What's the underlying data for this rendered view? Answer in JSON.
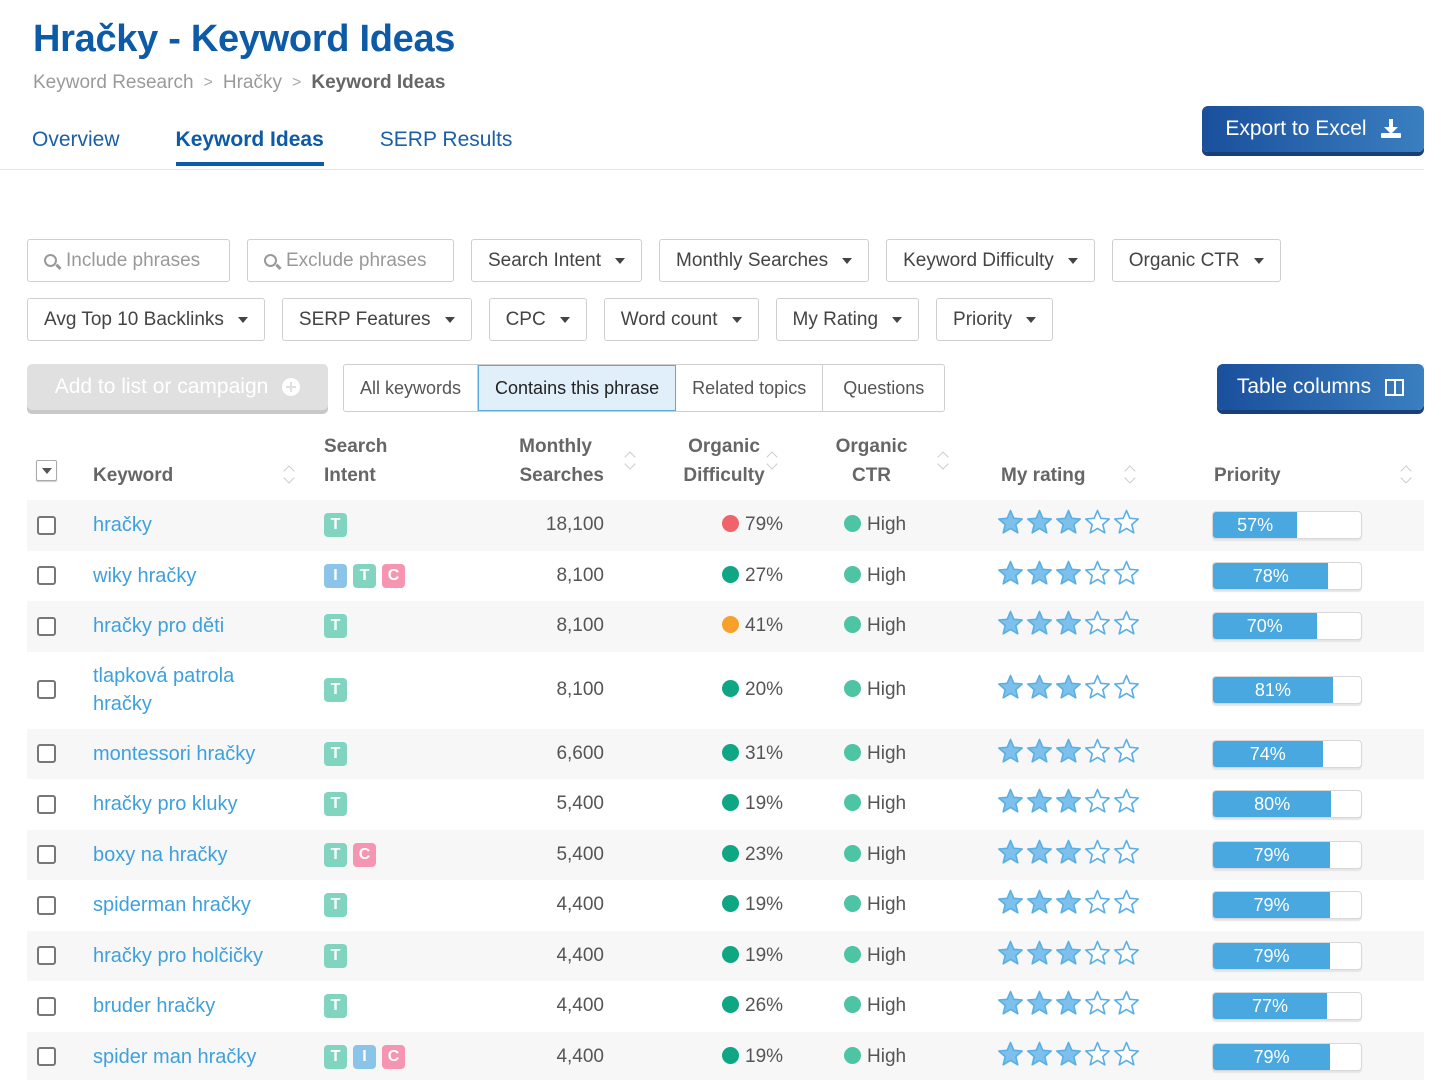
{
  "header": {
    "title": "Hračky - Keyword Ideas",
    "breadcrumb": [
      {
        "label": "Keyword Research"
      },
      {
        "label": "Hračky"
      },
      {
        "label": "Keyword Ideas"
      }
    ],
    "breadcrumb_separator": ">",
    "export_label": "Export to Excel"
  },
  "tabs": [
    {
      "label": "Overview",
      "active": false
    },
    {
      "label": "Keyword Ideas",
      "active": true
    },
    {
      "label": "SERP Results",
      "active": false
    }
  ],
  "filters": {
    "include_placeholder": "Include phrases",
    "exclude_placeholder": "Exclude phrases",
    "row1": [
      "Search Intent",
      "Monthly Searches",
      "Keyword Difficulty",
      "Organic CTR"
    ],
    "row2": [
      "Avg Top 10 Backlinks",
      "SERP Features",
      "CPC",
      "Word count",
      "My Rating",
      "Priority"
    ]
  },
  "toolbar": {
    "add_label": "Add to list or campaign",
    "segments": [
      "All keywords",
      "Contains this phrase",
      "Related topics",
      "Questions"
    ],
    "active_segment": "Contains this phrase",
    "table_columns_label": "Table columns"
  },
  "table": {
    "headers": {
      "keyword": "Keyword",
      "intent_1": "Search",
      "intent_2": "Intent",
      "searches_1": "Monthly",
      "searches_2": "Searches",
      "difficulty_1": "Organic",
      "difficulty_2": "Difficulty",
      "ctr_1": "Organic",
      "ctr_2": "CTR",
      "rating": "My rating",
      "priority": "Priority"
    },
    "colors": {
      "difficulty_hard": "#f0636b",
      "difficulty_medium": "#f7a12a",
      "difficulty_easy": "#0fa683",
      "ctr_high": "#4dc4a4",
      "star": "#5aafe4",
      "priority_fill": "#49a8e0"
    },
    "rows": [
      {
        "keyword": "hračky",
        "intent": [
          "T"
        ],
        "searches": "18,100",
        "difficulty": "79%",
        "difficulty_level": "hard",
        "ctr": "High",
        "rating": 3,
        "priority": 57,
        "priority_label": "57%"
      },
      {
        "keyword": "wiky hračky",
        "intent": [
          "I",
          "T",
          "C"
        ],
        "searches": "8,100",
        "difficulty": "27%",
        "difficulty_level": "easy",
        "ctr": "High",
        "rating": 3,
        "priority": 78,
        "priority_label": "78%"
      },
      {
        "keyword": "hračky pro děti",
        "intent": [
          "T"
        ],
        "searches": "8,100",
        "difficulty": "41%",
        "difficulty_level": "medium",
        "ctr": "High",
        "rating": 3,
        "priority": 70,
        "priority_label": "70%"
      },
      {
        "keyword": "tlapková patrola hračky",
        "intent": [
          "T"
        ],
        "searches": "8,100",
        "difficulty": "20%",
        "difficulty_level": "easy",
        "ctr": "High",
        "rating": 3,
        "priority": 81,
        "priority_label": "81%"
      },
      {
        "keyword": "montessori hračky",
        "intent": [
          "T"
        ],
        "searches": "6,600",
        "difficulty": "31%",
        "difficulty_level": "easy",
        "ctr": "High",
        "rating": 3,
        "priority": 74,
        "priority_label": "74%"
      },
      {
        "keyword": "hračky pro kluky",
        "intent": [
          "T"
        ],
        "searches": "5,400",
        "difficulty": "19%",
        "difficulty_level": "easy",
        "ctr": "High",
        "rating": 3,
        "priority": 80,
        "priority_label": "80%"
      },
      {
        "keyword": "boxy na hračky",
        "intent": [
          "T",
          "C"
        ],
        "searches": "5,400",
        "difficulty": "23%",
        "difficulty_level": "easy",
        "ctr": "High",
        "rating": 3,
        "priority": 79,
        "priority_label": "79%"
      },
      {
        "keyword": "spiderman hračky",
        "intent": [
          "T"
        ],
        "searches": "4,400",
        "difficulty": "19%",
        "difficulty_level": "easy",
        "ctr": "High",
        "rating": 3,
        "priority": 79,
        "priority_label": "79%"
      },
      {
        "keyword": "hračky pro holčičky",
        "intent": [
          "T"
        ],
        "searches": "4,400",
        "difficulty": "19%",
        "difficulty_level": "easy",
        "ctr": "High",
        "rating": 3,
        "priority": 79,
        "priority_label": "79%"
      },
      {
        "keyword": "bruder hračky",
        "intent": [
          "T"
        ],
        "searches": "4,400",
        "difficulty": "26%",
        "difficulty_level": "easy",
        "ctr": "High",
        "rating": 3,
        "priority": 77,
        "priority_label": "77%"
      },
      {
        "keyword": "spider man hračky",
        "intent": [
          "T",
          "I",
          "C"
        ],
        "searches": "4,400",
        "difficulty": "19%",
        "difficulty_level": "easy",
        "ctr": "High",
        "rating": 3,
        "priority": 79,
        "priority_label": "79%"
      }
    ]
  }
}
